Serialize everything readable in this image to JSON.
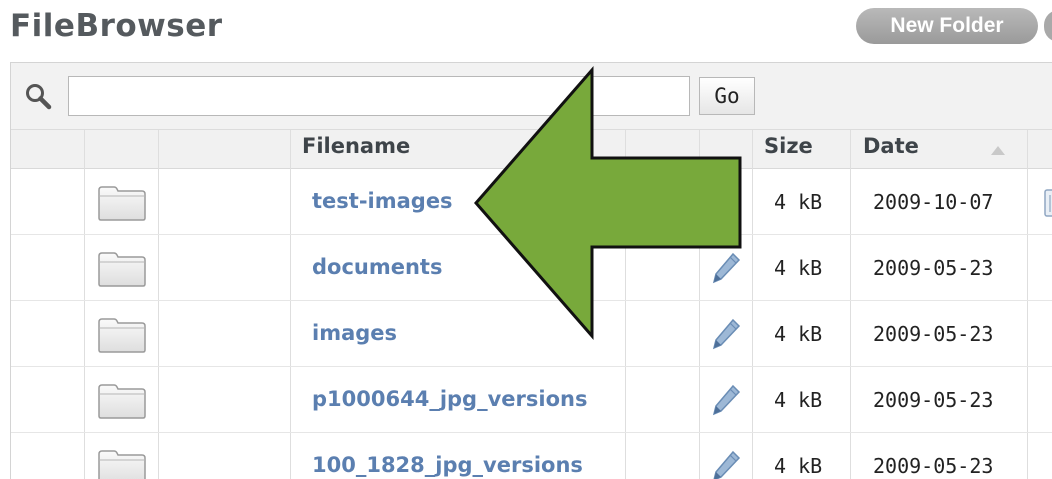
{
  "app": {
    "title": "FileBrowser"
  },
  "toolbar": {
    "new_folder_label": "New Folder"
  },
  "search": {
    "value": "",
    "placeholder": "",
    "go_label": "Go"
  },
  "table": {
    "columns": {
      "filename": "Filename",
      "size": "Size",
      "date": "Date"
    },
    "sort": {
      "column": "Date",
      "direction": "ascending"
    },
    "rows": [
      {
        "name": "test-images",
        "size": "4 kB",
        "date": "2009-10-07",
        "icon": "folder-icon",
        "editable": false
      },
      {
        "name": "documents",
        "size": "4 kB",
        "date": "2009-05-23",
        "icon": "folder-icon",
        "editable": true
      },
      {
        "name": "images",
        "size": "4 kB",
        "date": "2009-05-23",
        "icon": "folder-icon",
        "editable": true
      },
      {
        "name": "p1000644_jpg_versions",
        "size": "4 kB",
        "date": "2009-05-23",
        "icon": "folder-icon",
        "editable": true
      },
      {
        "name": "100_1828_jpg_versions",
        "size": "4 kB",
        "date": "2009-05-23",
        "icon": "folder-icon",
        "editable": true
      }
    ]
  },
  "annotation": {
    "type": "arrow",
    "direction": "left",
    "color": "#78a93b",
    "outline": "#111111"
  },
  "colors": {
    "link": "#5b7fb0",
    "title": "#555a5e",
    "header_bg": "#f1f1f1",
    "button_gray": "#a9a9a9"
  }
}
